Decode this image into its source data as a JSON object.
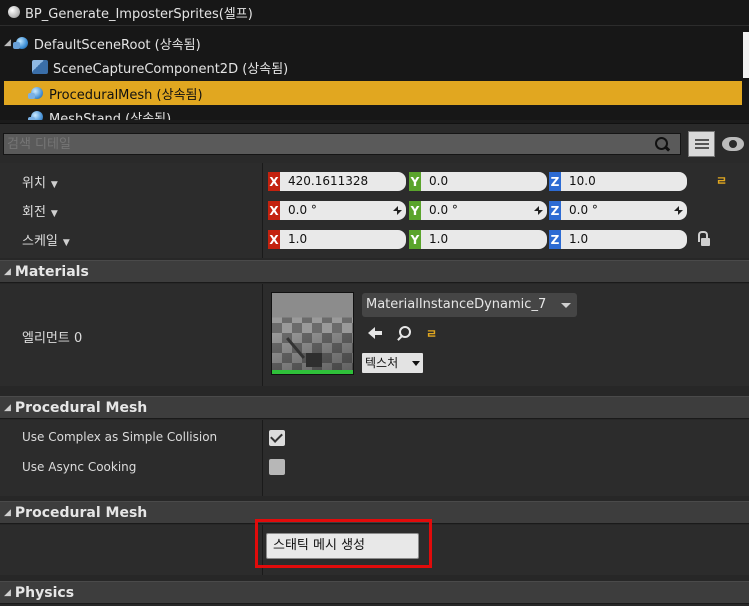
{
  "tree": {
    "items": [
      {
        "label": "BP_Generate_ImposterSprites(셀프)",
        "icon": "white-sphere-icon"
      },
      {
        "label": "DefaultSceneRoot (상속됨)",
        "icon": "scene-root-icon",
        "expander": "◢"
      },
      {
        "label": "SceneCaptureComponent2D (상속됨)",
        "icon": "scene-capture-icon"
      },
      {
        "label": "ProceduralMesh (상속됨)",
        "icon": "procedural-mesh-icon",
        "selected": true
      },
      {
        "label": "MeshStand (상속됨)",
        "icon": "mesh-stand-icon"
      }
    ]
  },
  "search": {
    "placeholder": "검색 디테일"
  },
  "transform": {
    "location_label": "위치",
    "rotation_label": "회전",
    "scale_label": "스케일",
    "axis_x": "X",
    "axis_y": "Y",
    "axis_z": "Z",
    "location": {
      "x": "420.1611328",
      "y": "0.0",
      "z": "10.0"
    },
    "rotation": {
      "x": "0.0 °",
      "y": "0.0 °",
      "z": "0.0 °"
    },
    "scale": {
      "x": "1.0",
      "y": "1.0",
      "z": "1.0"
    },
    "reset_glyph": "ㄹ"
  },
  "materials": {
    "header": "Materials",
    "element_label": "엘리먼트 0",
    "material_name": "MaterialInstanceDynamic_7",
    "texture_button": "텍스처"
  },
  "procedural_mesh": {
    "header": "Procedural Mesh",
    "use_complex_label": "Use Complex as Simple Collision",
    "use_complex_checked": true,
    "use_async_label": "Use Async Cooking",
    "use_async_checked": false
  },
  "procedural_mesh_2": {
    "header": "Procedural Mesh",
    "generate_button": "스태틱 메시 생성"
  },
  "physics": {
    "header": "Physics"
  },
  "colors": {
    "selection": "#e1a720",
    "axis_x": "#c4220f",
    "axis_y": "#5aa42c",
    "axis_z": "#2d6bd3",
    "highlight": "#e10b0b"
  }
}
